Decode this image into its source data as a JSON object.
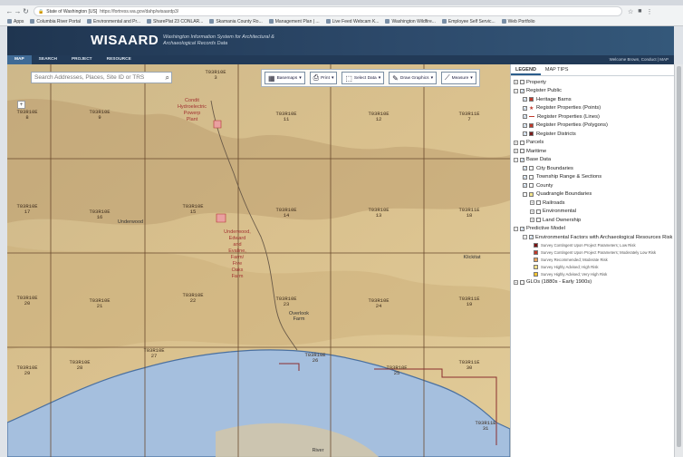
{
  "browser": {
    "secure_label": "State of Washington [US]",
    "url": "https://fortress.wa.gov/dahp/wisaardp3/",
    "bookmarks": [
      "Apps",
      "Columbia River Portal",
      "Environmental and Pr...",
      "SharePlat 23 CONLAR...",
      "Skamania County Ro...",
      "Management Plan | ...",
      "Live Feed Webcam K...",
      "Washington Wildfire...",
      "Employee Self Servic...",
      "Web Portfolio"
    ]
  },
  "header": {
    "logo": "WISAARD",
    "subtitle": "Washington Information System for Architectural & Archaeological Records Data",
    "welcome": "Welcome Brown, Conduct | MAP"
  },
  "nav": [
    "MAP",
    "SEARCH",
    "PROJECT",
    "RESOURCE"
  ],
  "search": {
    "placeholder": "Search Addresses, Places, Site ID or TRS"
  },
  "toolbar": {
    "basemaps": "Basemaps",
    "print": "Print",
    "select_data": "Select Data",
    "draw_graphics": "Draw Graphics",
    "measure": "Measure"
  },
  "map": {
    "colors": {
      "terrain": "#d8c08a",
      "water": "#a5bfde",
      "grid": "#6a4a2e",
      "parcel": "#8b2e2e"
    },
    "sections": [
      [
        "T03R10E\n3",
        230,
        6
      ],
      [
        "T03R10E\n8",
        22,
        50
      ],
      [
        "T03R10E\n9",
        102,
        50
      ],
      [
        "T03R10E\n11",
        308,
        52
      ],
      [
        "T03R10E\n12",
        410,
        52
      ],
      [
        "T03R11E\n7",
        510,
        52
      ],
      [
        "T03R10E\n17",
        22,
        154
      ],
      [
        "T03R10E\n16",
        102,
        160
      ],
      [
        "T03R10E\n15",
        205,
        154
      ],
      [
        "T03R10E\n14",
        308,
        158
      ],
      [
        "T03R10E\n13",
        410,
        158
      ],
      [
        "T03R11E\n18",
        510,
        158
      ],
      [
        "T03R10E\n20",
        22,
        255
      ],
      [
        "T03R10E\n21",
        102,
        258
      ],
      [
        "T03R10E\n22",
        205,
        252
      ],
      [
        "T03R10E\n23",
        308,
        256
      ],
      [
        "T03R10E\n24",
        410,
        258
      ],
      [
        "T03R11E\n19",
        510,
        256
      ],
      [
        "T03R10E\n27",
        162,
        313
      ],
      [
        "T03R10E\n26",
        340,
        318
      ],
      [
        "T03R10E\n29",
        22,
        332
      ],
      [
        "T03R10E\n28",
        80,
        326
      ],
      [
        "T03R10E\n25",
        430,
        332
      ],
      [
        "T03R11E\n30",
        510,
        326
      ],
      [
        "T03R11E\n31",
        528,
        393
      ]
    ],
    "pois": [
      [
        "Condit\nHydroelectric\nPowerp\nPlant",
        204,
        37
      ],
      [
        "Underwood,\nEdward\nand\nEvaline,\nFarm/\nFive\nOaks\nFarm",
        254,
        182
      ]
    ],
    "places": [
      [
        "Underwood",
        136,
        171
      ],
      [
        "Overlook\nFarm",
        322,
        272
      ],
      [
        "Klickitat",
        513,
        210
      ],
      [
        "River",
        343,
        423
      ]
    ]
  },
  "legend": {
    "tabs": [
      "LEGEND",
      "MAP TIPS"
    ],
    "layers": [
      {
        "label": "Property",
        "level": 0,
        "exp": "+",
        "check": false
      },
      {
        "label": "Register Public",
        "level": 0,
        "exp": "−",
        "check": true
      },
      {
        "label": "Heritage Barns",
        "level": 1,
        "check": true,
        "sym": "sq",
        "color": "#c0392b"
      },
      {
        "label": "Register Properties (Points)",
        "level": 1,
        "check": true,
        "sym": "star",
        "color": "#c0392b"
      },
      {
        "label": "Register Properties (Lines)",
        "level": 1,
        "check": true,
        "sym": "line",
        "color": "#c0392b"
      },
      {
        "label": "Register Properties (Polygons)",
        "level": 1,
        "check": true,
        "sym": "sq",
        "color": "#c0392b"
      },
      {
        "label": "Register Districts",
        "level": 1,
        "check": true,
        "sym": "sq",
        "color": "#7b1a1a"
      },
      {
        "label": "Parcels",
        "level": 0,
        "exp": "+",
        "check": false
      },
      {
        "label": "Maritime",
        "level": 0,
        "exp": "+",
        "check": false
      },
      {
        "label": "Base Data",
        "level": 0,
        "exp": "−",
        "check": true
      },
      {
        "label": "City Boundaries",
        "level": 1,
        "check": true,
        "sym": "sq",
        "color": "#ffffff"
      },
      {
        "label": "Township Range & Sections",
        "level": 1,
        "check": true,
        "sym": "sq",
        "color": "#ffffff"
      },
      {
        "label": "County",
        "level": 1,
        "check": true,
        "sym": "sq",
        "color": "#ffffff"
      },
      {
        "label": "Quadrangle Boundaries",
        "level": 1,
        "check": false,
        "sym": "sq",
        "color": "#f2e28a"
      },
      {
        "label": "Railroads",
        "level": 2,
        "exp": "+",
        "check": false
      },
      {
        "label": "Environmental",
        "level": 2,
        "exp": "+",
        "check": false
      },
      {
        "label": "Land Ownership",
        "level": 2,
        "exp": "+",
        "check": false
      },
      {
        "label": "Predictive Model",
        "level": 0,
        "exp": "−",
        "check": true
      },
      {
        "label": "Environmental Factors with Archaeological Resources Risk",
        "level": 1,
        "exp": "−",
        "check": true
      },
      {
        "label": "Survey Contingent Upon Project Parameters; Low Risk",
        "level": 3,
        "sym": "sq",
        "color": "#7a1212",
        "small": true
      },
      {
        "label": "Survey Contingent Upon Project Parameters; Moderately Low Risk",
        "level": 3,
        "sym": "sq",
        "color": "#c0392b",
        "small": true
      },
      {
        "label": "Survey Recommended; Moderate Risk",
        "level": 3,
        "sym": "sq",
        "color": "#e8a25a",
        "small": true
      },
      {
        "label": "Survey Highly Advised; High Risk",
        "level": 3,
        "sym": "sq",
        "color": "#f6e08a",
        "small": true
      },
      {
        "label": "Survey Highly Advised; Very High Risk",
        "level": 3,
        "sym": "sq",
        "color": "#f4c430",
        "small": true
      },
      {
        "label": "GLOs (1880s - Early 1900s)",
        "level": 0,
        "exp": "+",
        "check": false
      }
    ]
  }
}
